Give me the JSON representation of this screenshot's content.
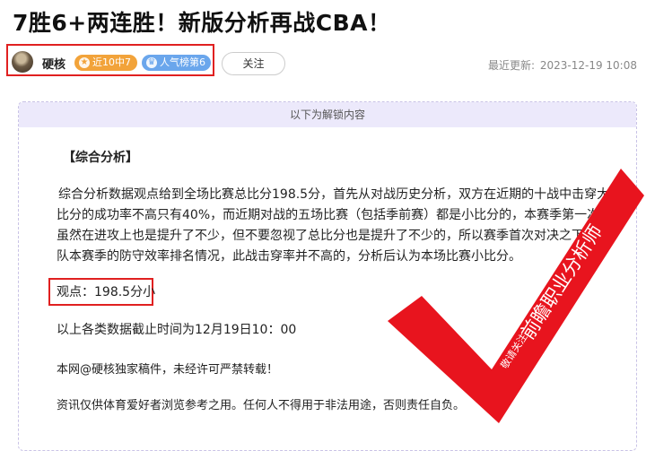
{
  "article": {
    "title": "7胜6+两连胜！新版分析再战CBA！"
  },
  "author": {
    "name": "硬核",
    "badge_streak": "近10中7",
    "badge_popularity": "人气榜第6",
    "follow_label": "关注"
  },
  "meta": {
    "updated_label": "最近更新:",
    "updated_value": "2023-12-19 10:08"
  },
  "content": {
    "unlock_notice": "以下为解锁内容",
    "section_heading": "【综合分析】",
    "paragraph_lines": [
      "综合分析数据观点给到全场比赛总比分198.5分，首先从对战历史分析，双方在近期的十战中击穿大",
      "比分的成功率不高只有40%，而近期对战的五场比赛（包括季前赛）都是小比分的，本赛季第一次相",
      "虽然在进攻上也是提升了不少，但不要忽视了总比分也是提升了不少的，所以赛季首次对决之下，",
      "队本赛季的防守效率排名情况，此战击穿率并不高的，分析后认为本场比赛小比分。"
    ],
    "viewpoint": "观点：198.5分小",
    "data_cutoff": "以上各类数据截止时间为12月19日10：00",
    "copyright": "本网@硬核独家稿件，未经许可严禁转载！",
    "disclaimer": "资讯仅供体育爱好者浏览参考之用。任何人不得用于非法用途，否则责任自负。"
  },
  "watermark": {
    "text_small": "敬请关注",
    "text_large": "前瞻职业分析师",
    "color": "#e8141e"
  }
}
